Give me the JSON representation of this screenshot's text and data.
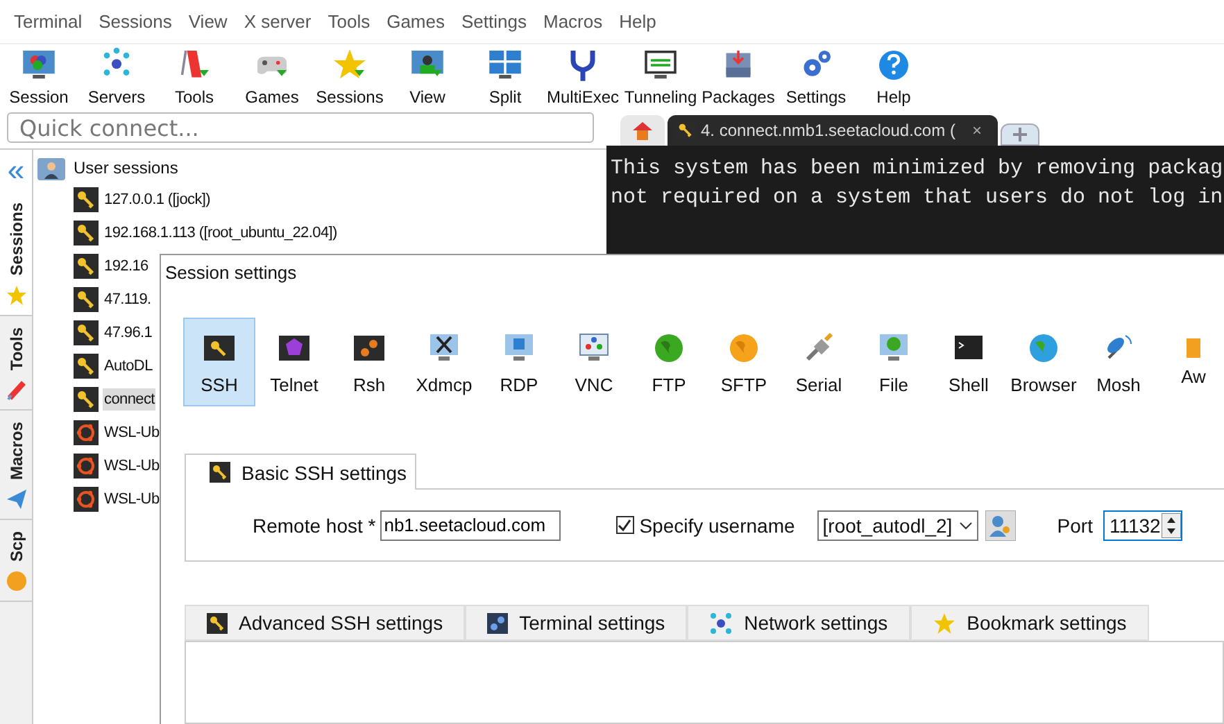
{
  "menu": [
    "Terminal",
    "Sessions",
    "View",
    "X server",
    "Tools",
    "Games",
    "Settings",
    "Macros",
    "Help"
  ],
  "toolbar": [
    "Session",
    "Servers",
    "Tools",
    "Games",
    "Sessions",
    "View",
    "Split",
    "MultiExec",
    "Tunneling",
    "Packages",
    "Settings",
    "Help"
  ],
  "quick_connect": {
    "placeholder": "Quick connect..."
  },
  "side_collapse": "«",
  "side_tabs": [
    {
      "label": "Sessions",
      "selected": true
    },
    {
      "label": "Tools",
      "selected": false
    },
    {
      "label": "Macros",
      "selected": false
    },
    {
      "label": "Scp",
      "selected": false
    }
  ],
  "sessions": {
    "label": "User sessions",
    "children": [
      {
        "label": "127.0.0.1 ([jock])",
        "kind": "ssh",
        "selected": false
      },
      {
        "label": "192.168.1.113 ([root_ubuntu_22.04])",
        "kind": "ssh",
        "selected": false
      },
      {
        "label": "192.16",
        "kind": "ssh",
        "selected": false
      },
      {
        "label": "47.119.",
        "kind": "ssh",
        "selected": false
      },
      {
        "label": "47.96.1",
        "kind": "ssh",
        "selected": false
      },
      {
        "label": "AutoDL",
        "kind": "ssh",
        "selected": false
      },
      {
        "label": "connect",
        "kind": "ssh",
        "selected": true
      },
      {
        "label": "WSL-Ub",
        "kind": "wsl",
        "selected": false
      },
      {
        "label": "WSL-Ub",
        "kind": "wsl",
        "selected": false
      },
      {
        "label": "WSL-Ub",
        "kind": "wsl",
        "selected": false
      }
    ]
  },
  "terminal": {
    "tabs": [
      {
        "kind": "home",
        "selected": false
      },
      {
        "kind": "session",
        "label": "4. connect.nmb1.seetacloud.com (",
        "close": "×",
        "selected": true
      },
      {
        "kind": "new",
        "selected": false
      }
    ],
    "lines": [
      "This system has been minimized by removing packag",
      "not required on a system that users do not log in"
    ]
  },
  "dialog": {
    "title": "Session settings",
    "types": [
      {
        "label": "SSH",
        "selected": true
      },
      {
        "label": "Telnet",
        "selected": false
      },
      {
        "label": "Rsh",
        "selected": false
      },
      {
        "label": "Xdmcp",
        "selected": false
      },
      {
        "label": "RDP",
        "selected": false
      },
      {
        "label": "VNC",
        "selected": false
      },
      {
        "label": "FTP",
        "selected": false
      },
      {
        "label": "SFTP",
        "selected": false
      },
      {
        "label": "Serial",
        "selected": false
      },
      {
        "label": "File",
        "selected": false
      },
      {
        "label": "Shell",
        "selected": false
      },
      {
        "label": "Browser",
        "selected": false
      },
      {
        "label": "Mosh",
        "selected": false
      },
      {
        "label": "Aw",
        "selected": false
      }
    ],
    "basic_tab": {
      "label": "Basic SSH settings",
      "selected": true
    },
    "remote_host": {
      "label": "Remote host *",
      "value": "nb1.seetacloud.com"
    },
    "specify_username": {
      "label": "Specify username",
      "checked": true
    },
    "username": {
      "value": "[root_autodl_2]"
    },
    "port": {
      "label": "Port",
      "value": "11132"
    },
    "lower_tabs": [
      {
        "label": "Advanced SSH settings",
        "selected": false
      },
      {
        "label": "Terminal settings",
        "selected": false
      },
      {
        "label": "Network settings",
        "selected": false
      },
      {
        "label": "Bookmark settings",
        "selected": false
      }
    ]
  }
}
